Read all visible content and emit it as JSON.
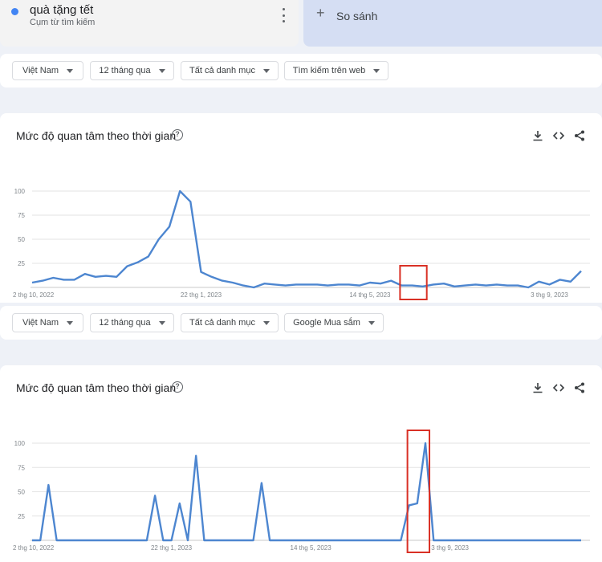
{
  "term": {
    "name": "quà tặng tết",
    "subtitle": "Cụm từ tìm kiếm"
  },
  "compare": {
    "label": "So sánh"
  },
  "colors": {
    "series": "#4d86d0",
    "highlight": "#d93025",
    "grid": "#e3e3e3",
    "axis_text": "#80868b"
  },
  "panels": [
    {
      "filters": [
        {
          "label": "Việt Nam"
        },
        {
          "label": "12 tháng qua"
        },
        {
          "label": "Tất cả danh mục"
        },
        {
          "label": "Tìm kiếm trên web"
        }
      ],
      "title": "Mức độ quan tâm theo thời gian",
      "tools": [
        "download-icon",
        "embed-icon",
        "share-icon"
      ],
      "chart_data": {
        "type": "line",
        "title": "",
        "xlabel": "",
        "ylabel": "",
        "ylim": [
          0,
          100
        ],
        "yticks": [
          25,
          50,
          75,
          100
        ],
        "grid": true,
        "xtick_labels": [
          "2 thg 10, 2022",
          "22 thg 1, 2023",
          "14 thg 5, 2023",
          "3 thg 9, 2023"
        ],
        "xtick_index": [
          0,
          16,
          32,
          49
        ],
        "values": [
          5,
          7,
          10,
          8,
          8,
          14,
          11,
          12,
          11,
          22,
          26,
          32,
          50,
          63,
          100,
          89,
          16,
          11,
          7,
          5,
          2,
          0,
          4,
          3,
          2,
          3,
          3,
          3,
          2,
          3,
          3,
          2,
          5,
          4,
          7,
          2,
          2,
          1,
          3,
          4,
          1,
          2,
          3,
          2,
          3,
          2,
          2,
          0,
          6,
          3,
          8,
          6,
          17
        ],
        "highlight_index": [
          35,
          37
        ]
      }
    },
    {
      "filters": [
        {
          "label": "Việt Nam"
        },
        {
          "label": "12 tháng qua"
        },
        {
          "label": "Tất cả danh mục"
        },
        {
          "label": "Google Mua sắm"
        }
      ],
      "title": "Mức độ quan tâm theo thời gian",
      "tools": [
        "download-icon",
        "embed-icon",
        "share-icon"
      ],
      "chart_data": {
        "type": "line",
        "title": "",
        "xlabel": "",
        "ylabel": "",
        "ylim": [
          0,
          100
        ],
        "yticks": [
          25,
          50,
          75,
          100
        ],
        "grid": true,
        "xtick_labels": [
          "2 thg 10, 2022",
          "22 thg 1, 2023",
          "14 thg 5, 2023",
          "3 thg 9, 2023"
        ],
        "xtick_index": [
          0,
          17,
          34,
          51
        ],
        "values": [
          0,
          0,
          57,
          0,
          0,
          0,
          0,
          0,
          0,
          0,
          0,
          0,
          0,
          0,
          0,
          46,
          0,
          0,
          38,
          0,
          87,
          0,
          0,
          0,
          0,
          0,
          0,
          0,
          59,
          0,
          0,
          0,
          0,
          0,
          0,
          0,
          0,
          0,
          0,
          0,
          0,
          0,
          0,
          0,
          0,
          0,
          36,
          38,
          100,
          0,
          0,
          0,
          0,
          0,
          0,
          0,
          0,
          0,
          0,
          0,
          0,
          0,
          0,
          0,
          0,
          0,
          0,
          0
        ],
        "highlight_index": [
          46,
          48
        ]
      }
    }
  ]
}
